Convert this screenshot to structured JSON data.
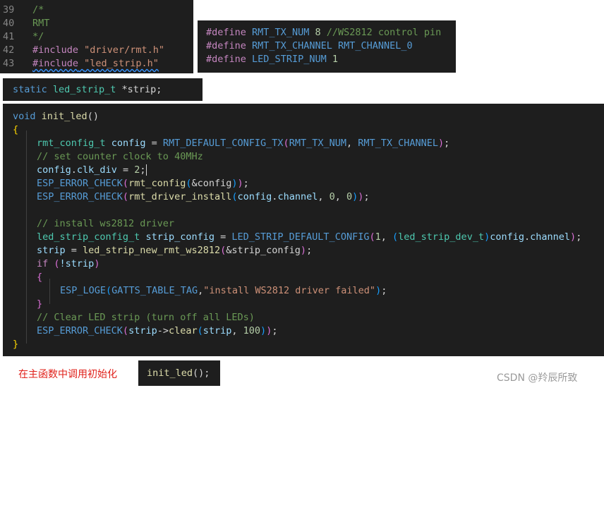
{
  "panel_includes": {
    "lines": [
      {
        "num": "39",
        "text": "/*"
      },
      {
        "num": "40",
        "text": "RMT"
      },
      {
        "num": "41",
        "text": "*/"
      },
      {
        "num": "42",
        "directive": "#include",
        "path": "\"driver/rmt.h\""
      },
      {
        "num": "43",
        "directive": "#include",
        "path": "\"led_strip.h\""
      }
    ]
  },
  "panel_defines": {
    "lines": [
      {
        "directive": "#define",
        "name": "RMT_TX_NUM",
        "value": "8",
        "comment": "//WS2812 control pin"
      },
      {
        "directive": "#define",
        "name": "RMT_TX_CHANNEL",
        "value": "RMT_CHANNEL_0"
      },
      {
        "directive": "#define",
        "name": "LED_STRIP_NUM",
        "value": "1"
      }
    ]
  },
  "panel_decl": {
    "keyword": "static",
    "type": "led_strip_t",
    "rest": " *strip;"
  },
  "panel_init": {
    "l1": {
      "kw": "void",
      "fn": "init_led",
      "rest": "()"
    },
    "open_brace": "{",
    "l3": {
      "type": "rmt_config_t",
      "var": "config",
      "eq": " = ",
      "macro": "RMT_DEFAULT_CONFIG_TX",
      "arg1": "RMT_TX_NUM",
      "arg2": "RMT_TX_CHANNEL",
      "end": ";"
    },
    "l4": "// set counter clock to 40MHz",
    "l5": {
      "var": "config",
      "field": "clk_div",
      "rest": " = ",
      "num": "2",
      "end": ";"
    },
    "l6": {
      "macro": "ESP_ERROR_CHECK",
      "fn": "rmt_config",
      "arg": "&config",
      "end": ";"
    },
    "l7": {
      "macro": "ESP_ERROR_CHECK",
      "fn": "rmt_driver_install",
      "var": "config",
      "field": "channel",
      "n1": "0",
      "n2": "0",
      "end": ";"
    },
    "l9": "// install ws2812 driver",
    "l10": {
      "type": "led_strip_config_t",
      "var": "strip_config",
      "macro": "LED_STRIP_DEFAULT_CONFIG",
      "n": "1",
      "cast": "led_strip_dev_t",
      "obj": "config",
      "field": "channel",
      "end": ";"
    },
    "l11": {
      "var": "strip",
      "fn": "led_strip_new_rmt_ws2812",
      "arg": "&strip_config",
      "end": ";"
    },
    "l12": {
      "kw": "if",
      "cond": "!strip"
    },
    "l13": "{",
    "l14": {
      "fn": "ESP_LOGE",
      "tag": "GATTS_TABLE_TAG",
      "str": "\"install WS2812 driver failed\"",
      "end": ";"
    },
    "l15": "}",
    "l16": "// Clear LED strip (turn off all LEDs)",
    "l17": {
      "macro": "ESP_ERROR_CHECK",
      "var": "strip",
      "fn": "clear",
      "arg": "strip",
      "n": "100",
      "end": ";"
    },
    "close_brace": "}"
  },
  "footer": {
    "caption": "在主函数中调用初始化",
    "call_fn": "init_led",
    "call_rest": "();",
    "watermark": "CSDN @羚辰所致"
  }
}
